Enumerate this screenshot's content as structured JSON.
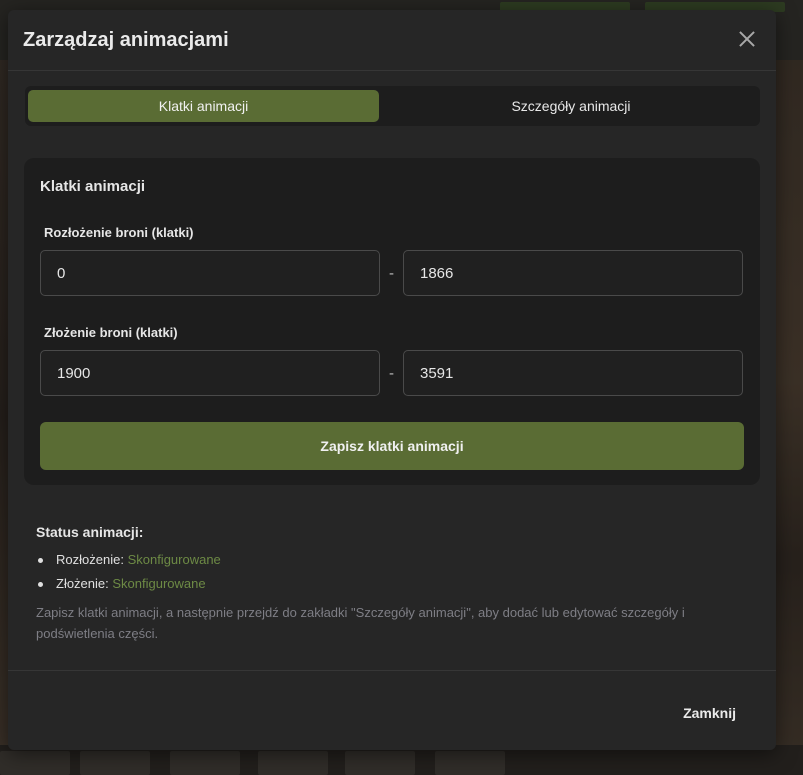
{
  "modal": {
    "title": "Zarządzaj animacjami",
    "close_icon": "close-icon"
  },
  "tabs": [
    {
      "label": "Klatki animacji",
      "active": true
    },
    {
      "label": "Szczegóły animacji",
      "active": false
    }
  ],
  "frames_card": {
    "title": "Klatki animacji",
    "unfold": {
      "label": "Rozłożenie broni (klatki)",
      "start": "0",
      "end": "1866"
    },
    "fold": {
      "label": "Złożenie broni (klatki)",
      "start": "1900",
      "end": "3591"
    },
    "separator": "-",
    "save_label": "Zapisz klatki animacji"
  },
  "status": {
    "title": "Status animacji:",
    "items": [
      {
        "label": "Rozłożenie:",
        "value": "Skonfigurowane"
      },
      {
        "label": "Złożenie:",
        "value": "Skonfigurowane"
      }
    ],
    "hint": "Zapisz klatki animacji, a następnie przejdź do zakładki \"Szczegóły animacji\", aby dodać lub edytować szczegóły i podświetlenia części."
  },
  "footer": {
    "close_label": "Zamknij"
  },
  "colors": {
    "accent": "#5a6c34",
    "status_ok": "#6d8a45",
    "modal_bg": "#262626",
    "card_bg": "#1d1d1d"
  }
}
